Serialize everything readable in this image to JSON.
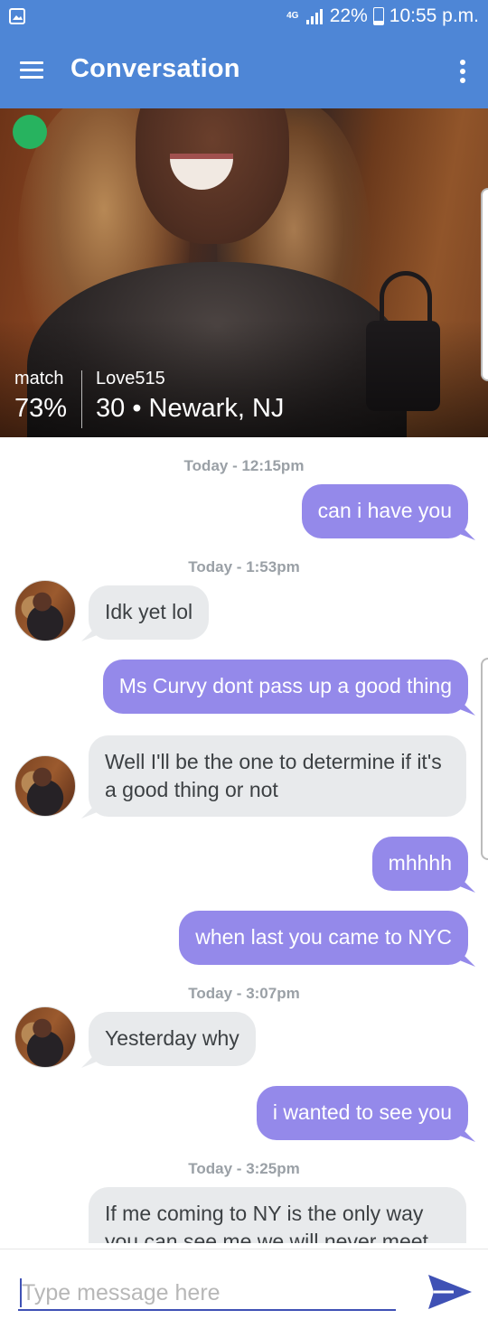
{
  "status_bar": {
    "network": "4G",
    "battery": "22%",
    "battery_level": 0.22,
    "time": "10:55 p.m."
  },
  "app_bar": {
    "title": "Conversation",
    "menu_icon": "hamburger-menu-icon",
    "more_icon": "more-vert-icon"
  },
  "profile": {
    "online": true,
    "match_label": "match",
    "match_value": "73%",
    "username": "Love515",
    "age_location": "30 • Newark, NJ"
  },
  "messages": [
    {
      "type": "timestamp",
      "text": "Today - 12:15pm"
    },
    {
      "type": "out",
      "text": "can i have you"
    },
    {
      "type": "timestamp",
      "text": "Today - 1:53pm"
    },
    {
      "type": "in",
      "text": "Idk yet lol"
    },
    {
      "type": "out",
      "text": "Ms Curvy dont pass up a good thing"
    },
    {
      "type": "in",
      "text": "Well I'll be the one to determine if it's a good thing or not"
    },
    {
      "type": "out",
      "text": "mhhhh"
    },
    {
      "type": "out",
      "text": "when last you came to NYC"
    },
    {
      "type": "timestamp",
      "text": "Today - 3:07pm"
    },
    {
      "type": "in",
      "text": "Yesterday why"
    },
    {
      "type": "out",
      "text": "i wanted to see you"
    },
    {
      "type": "timestamp",
      "text": "Today - 3:25pm"
    },
    {
      "type": "in",
      "text": "If me coming to NY is the only way you can see me we will never meet"
    }
  ],
  "composer": {
    "placeholder": "Type message here",
    "send_icon": "send-icon"
  },
  "colors": {
    "app_bar": "#4e86d6",
    "outgoing_bubble": "#9489ea",
    "incoming_bubble": "#e8eaec",
    "online": "#27b35f",
    "input_underline": "#3f51b5"
  }
}
